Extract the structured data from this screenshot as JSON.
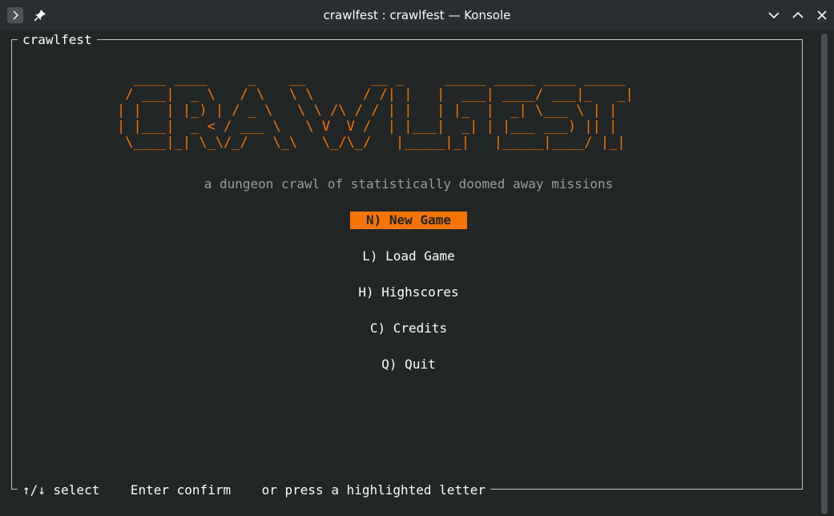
{
  "window": {
    "title": "crawlfest : crawlfest — Konsole"
  },
  "icons": {
    "menu": "chevron-right-icon",
    "pin": "pin-icon",
    "minimize": "chevron-down-icon",
    "maximize": "chevron-up-icon",
    "close": "close-icon"
  },
  "screen": {
    "frame_title": "crawlfest",
    "logo": "  ____ ____     _    __        __ _     _____ _____ ____ _____\n / ___|  _ \\   / \\   \\ \\      / /| |   |  ___| ____/ ___|_   _|\n| |   | |_) | / _ \\   \\ \\ /\\ / / | |   | |_  |  _| \\___ \\ | |\n| |___|  _ < / ___ \\   \\ V  V /  | |___|  _| | |___ ___) || |\n \\____|_| \\_\\/_/   \\_\\   \\_/\\_/   |_____|_|   |_____|____/ |_|",
    "tagline": "a dungeon crawl of statistically doomed away missions",
    "menu": [
      {
        "label": "N) New Game",
        "selected": true
      },
      {
        "label": "L) Load Game",
        "selected": false
      },
      {
        "label": "H) Highscores",
        "selected": false
      },
      {
        "label": "C) Credits",
        "selected": false
      },
      {
        "label": "Q) Quit",
        "selected": false
      }
    ],
    "footer": "↑/↓ select    Enter confirm    or press a highlighted letter"
  },
  "colors": {
    "accent": "#f67400",
    "background": "#232627",
    "text": "#fcfcfc",
    "muted": "#9a9e9f"
  }
}
